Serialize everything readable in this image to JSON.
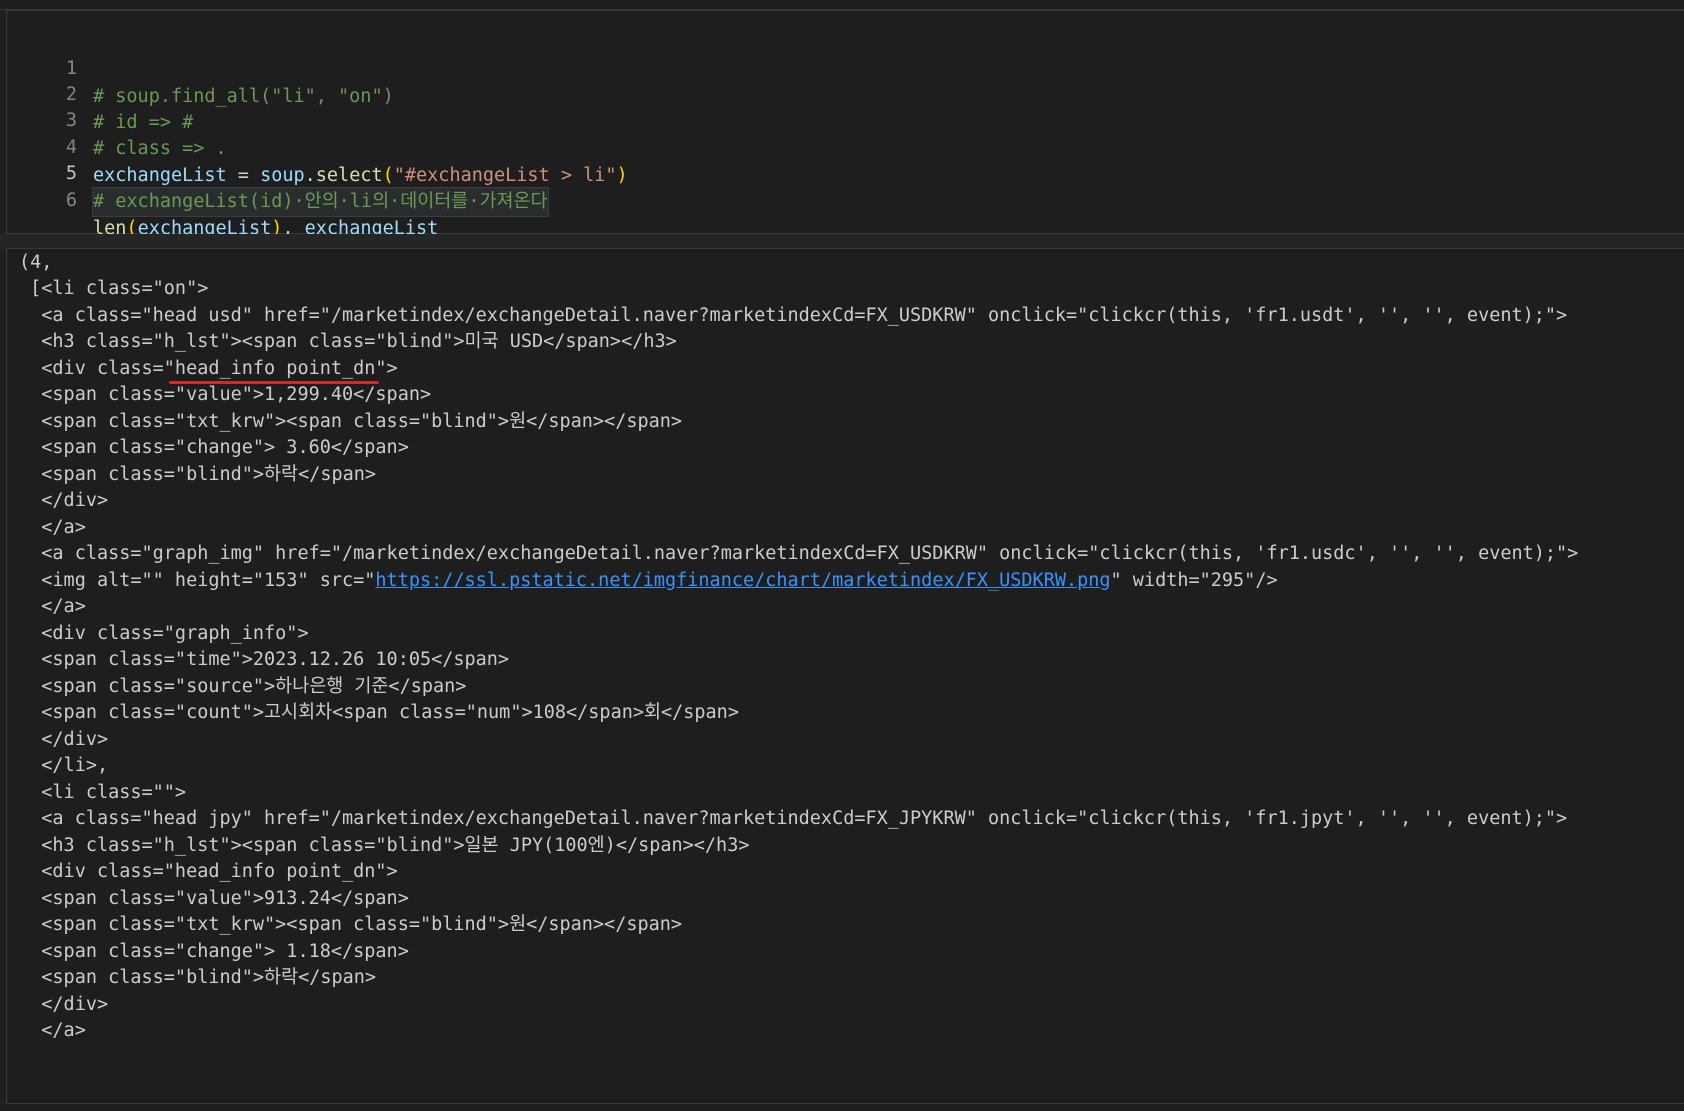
{
  "input_cell": {
    "lines": [
      {
        "num": "1",
        "text": "# soup.find_all(\"li\", \"on\")"
      },
      {
        "num": "2",
        "text": "# id => #"
      },
      {
        "num": "3",
        "text": "# class => ."
      },
      {
        "num": "4",
        "parts": {
          "var": "exchangeList",
          "eq": " = ",
          "obj": "soup",
          "dot": ".",
          "fn": "select",
          "open": "(",
          "str": "\"#exchangeList > li\"",
          "close": ")"
        }
      },
      {
        "num": "5",
        "text": "# exchangeList(id)·안의·li의·데이터를·가져온다"
      },
      {
        "num": "6",
        "parts": {
          "fn": "len",
          "open": "(",
          "arg": "exchangeList",
          "close": ")",
          "comma": ", ",
          "var": "exchangeList"
        }
      }
    ]
  },
  "output_cell": {
    "lines": [
      "(4,",
      " [<li class=\"on\">",
      "  <a class=\"head usd\" href=\"/marketindex/exchangeDetail.naver?marketindexCd=FX_USDKRW\" onclick=\"clickcr(this, 'fr1.usdt', '', '', event);\">",
      "  <h3 class=\"h_lst\"><span class=\"blind\">미국 USD</span></h3>",
      "  <div class=\"head_info point_dn\">",
      "  <span class=\"value\">1,299.40</span>",
      "  <span class=\"txt_krw\"><span class=\"blind\">원</span></span>",
      "  <span class=\"change\"> 3.60</span>",
      "  <span class=\"blind\">하락</span>",
      "  </div>",
      "  </a>",
      "  <a class=\"graph_img\" href=\"/marketindex/exchangeDetail.naver?marketindexCd=FX_USDKRW\" onclick=\"clickcr(this, 'fr1.usdc', '', '', event);\">",
      "",
      "  </a>",
      "  <div class=\"graph_info\">",
      "  <span class=\"time\">2023.12.26 10:05</span>",
      "  <span class=\"source\">하나은행 기준</span>",
      "  <span class=\"count\">고시회차<span class=\"num\">108</span>회</span>",
      "  </div>",
      "  </li>,",
      "  <li class=\"\">",
      "  <a class=\"head jpy\" href=\"/marketindex/exchangeDetail.naver?marketindexCd=FX_JPYKRW\" onclick=\"clickcr(this, 'fr1.jpyt', '', '', event);\">",
      "  <h3 class=\"h_lst\"><span class=\"blind\">일본 JPY(100엔)</span></h3>",
      "  <div class=\"head_info point_dn\">",
      "  <span class=\"value\">913.24</span>",
      "  <span class=\"txt_krw\"><span class=\"blind\">원</span></span>",
      "  <span class=\"change\"> 1.18</span>",
      "  <span class=\"blind\">하락</span>",
      "  </div>",
      "  </a>"
    ],
    "img_line": {
      "prefix": "  <img alt=\"\" height=\"153\" src=\"",
      "link": "https://ssl.pstatic.net/imgfinance/chart/marketindex/FX_USDKRW.png",
      "suffix": "\" width=\"295\"/>"
    }
  },
  "colors": {
    "background": "#1e1e1e",
    "comment": "#6a9955",
    "variable": "#9cdcfe",
    "function": "#dcdcaa",
    "bracket": "#ffd700",
    "string": "#ce9178",
    "link": "#3794ff",
    "annotation_underline": "#d12a2a"
  }
}
